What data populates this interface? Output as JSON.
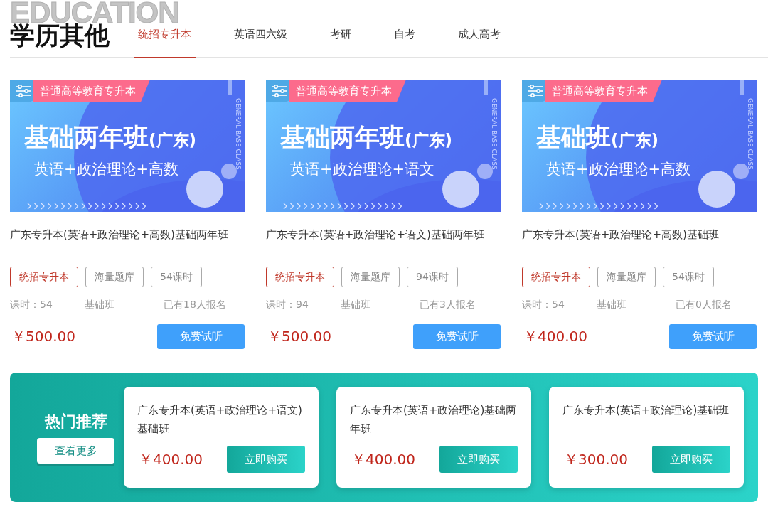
{
  "header": {
    "watermark": "EDUCATION",
    "title": "学历其他",
    "tabs": [
      {
        "label": "统招专升本",
        "selected": true
      },
      {
        "label": "英语四六级",
        "selected": false
      },
      {
        "label": "考研",
        "selected": false
      },
      {
        "label": "自考",
        "selected": false
      },
      {
        "label": "成人高考",
        "selected": false
      }
    ]
  },
  "courses": [
    {
      "banner": {
        "badge": "普通高等教育专升本",
        "headline": "基础两年班",
        "region": "(广东)",
        "subjects": "英语+政治理论+高数",
        "side_text": "GENERAL BASE CLASS"
      },
      "title": "广东专升本(英语+政治理论+高数)基础两年班",
      "tags": [
        {
          "label": "统招专升本",
          "kind": "highlight"
        },
        {
          "label": "海量题库",
          "kind": "plain"
        },
        {
          "label": "54课时",
          "kind": "plain"
        }
      ],
      "hours": "课时：54",
      "class_type": "基础班",
      "enrolled": "已有18人报名",
      "price": "￥500.00",
      "button": "免费试听"
    },
    {
      "banner": {
        "badge": "普通高等教育专升本",
        "headline": "基础两年班",
        "region": "(广东)",
        "subjects": "英语+政治理论+语文",
        "side_text": "GENERAL BASE CLASS"
      },
      "title": "广东专升本(英语+政治理论+语文)基础两年班",
      "tags": [
        {
          "label": "统招专升本",
          "kind": "highlight"
        },
        {
          "label": "海量题库",
          "kind": "plain"
        },
        {
          "label": "94课时",
          "kind": "plain"
        }
      ],
      "hours": "课时：94",
      "class_type": "基础班",
      "enrolled": "已有3人报名",
      "price": "￥500.00",
      "button": "免费试听"
    },
    {
      "banner": {
        "badge": "普通高等教育专升本",
        "headline": "基础班",
        "region": "(广东)",
        "subjects": "英语+政治理论+高数",
        "side_text": "GENERAL BASE CLASS"
      },
      "title": "广东专升本(英语+政治理论+高数)基础班",
      "tags": [
        {
          "label": "统招专升本",
          "kind": "highlight"
        },
        {
          "label": "海量题库",
          "kind": "plain"
        },
        {
          "label": "54课时",
          "kind": "plain"
        }
      ],
      "hours": "课时：54",
      "class_type": "基础班",
      "enrolled": "已有0人报名",
      "price": "￥400.00",
      "button": "免费试听"
    }
  ],
  "recommend": {
    "heading": "热门推荐",
    "more_button": "查看更多",
    "items": [
      {
        "title": "广东专升本(英语+政治理论+语文)基础班",
        "price": "￥400.00",
        "button": "立即购买"
      },
      {
        "title": "广东专升本(英语+政治理论)基础两年班",
        "price": "￥400.00",
        "button": "立即购买"
      },
      {
        "title": "广东专升本(英语+政治理论)基础班",
        "price": "￥300.00",
        "button": "立即购买"
      }
    ]
  }
}
